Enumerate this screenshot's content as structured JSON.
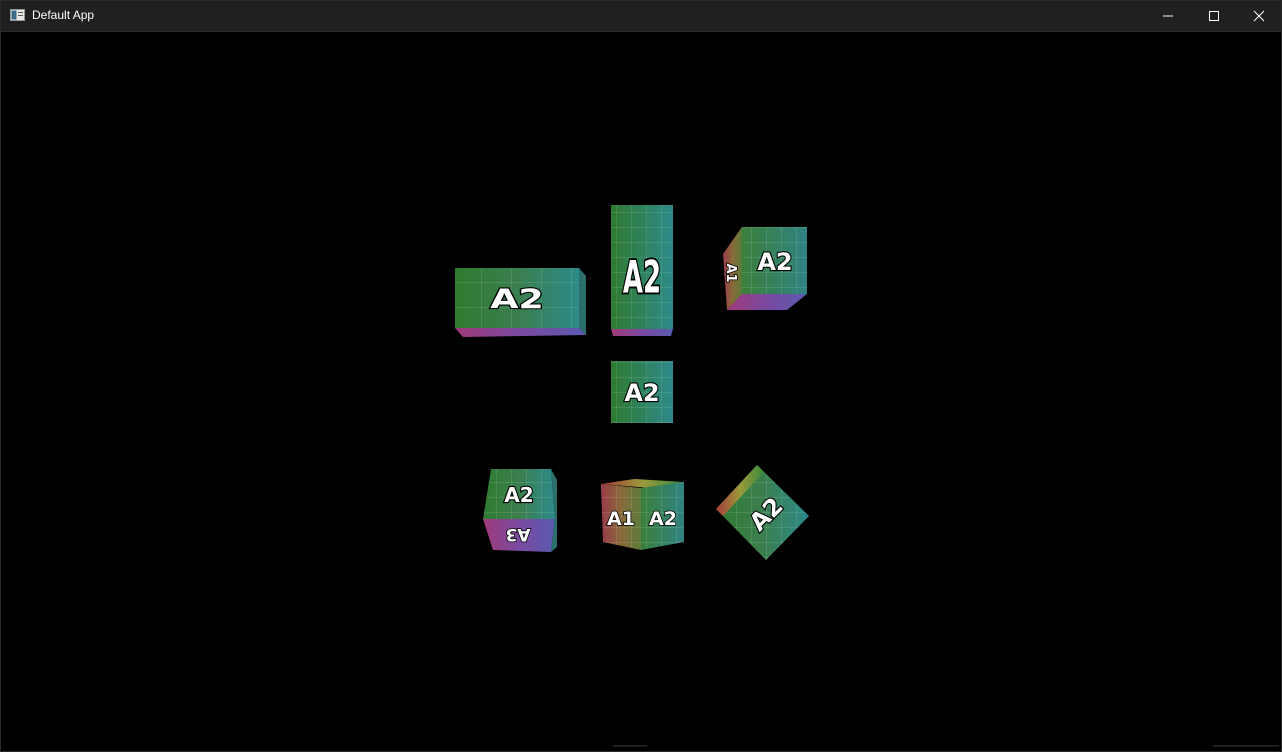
{
  "window": {
    "title": "Default App",
    "icon": "app-window-icon",
    "controls": [
      "minimize-icon",
      "maximize-icon",
      "close-icon"
    ]
  },
  "colors": {
    "titlebar": "#202020",
    "background": "#000000",
    "face_green": "#3c7d3c",
    "face_teal": "#2e8a8a",
    "face_purple": "#7a3f9a",
    "face_red": "#9b3a3a"
  },
  "cubes": [
    {
      "name": "cube-1",
      "front_label": "A2"
    },
    {
      "name": "cube-2",
      "front_label": "A2"
    },
    {
      "name": "cube-3",
      "front_label": "A2",
      "side_label": "A1"
    },
    {
      "name": "cube-4",
      "front_label": "A2"
    },
    {
      "name": "cube-5",
      "front_label": "A2",
      "bottom_label": "A3"
    },
    {
      "name": "cube-6",
      "left_label": "A1",
      "right_label": "A2"
    },
    {
      "name": "cube-7",
      "front_label": "A2"
    }
  ]
}
